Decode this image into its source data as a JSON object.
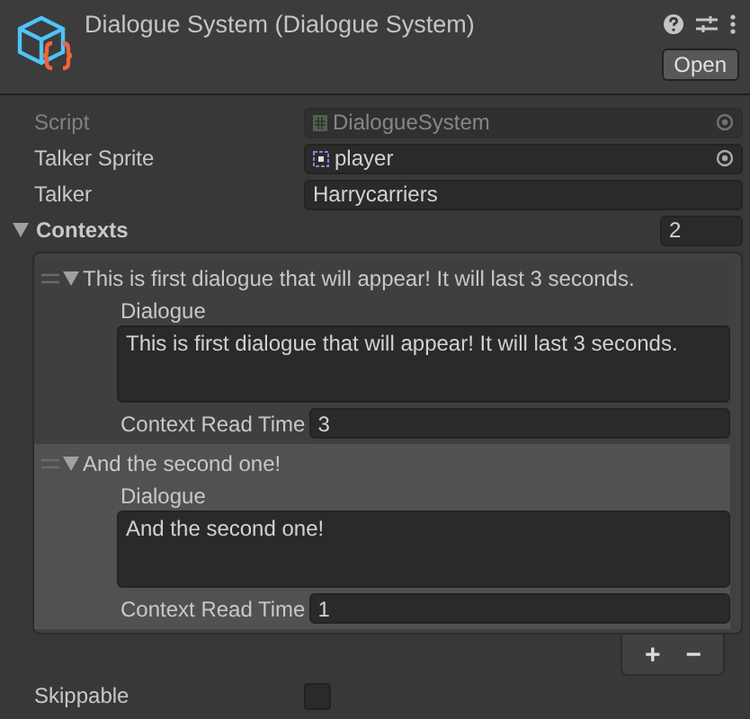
{
  "header": {
    "title": "Dialogue System (Dialogue System)",
    "open_button": "Open"
  },
  "fields": [
    {
      "kind": "object",
      "label": "Script",
      "value": "DialogueSystem",
      "disabled": true
    },
    {
      "kind": "object",
      "label": "Talker Sprite",
      "value": "player",
      "disabled": false
    },
    {
      "kind": "text",
      "label": "Talker",
      "value": "Harrycarriers",
      "disabled": false
    }
  ],
  "contexts": {
    "label": "Contexts",
    "expanded": true,
    "count": "2",
    "elements": [
      {
        "title": "This is first dialogue that will appear! It will last 3 seconds.",
        "expanded": true,
        "selected": false,
        "dialogue_label": "Dialogue",
        "dialogue": "This is first dialogue that will appear! It will last 3 seconds.",
        "time_label": "Context Read Time",
        "time": "3"
      },
      {
        "title": "And the second one!",
        "expanded": true,
        "selected": true,
        "dialogue_label": "Dialogue",
        "dialogue": "And the second one!",
        "time_label": "Context Read Time",
        "time": "1"
      }
    ],
    "add": "+",
    "remove": "−"
  },
  "skippable": {
    "label": "Skippable",
    "checked": false
  }
}
